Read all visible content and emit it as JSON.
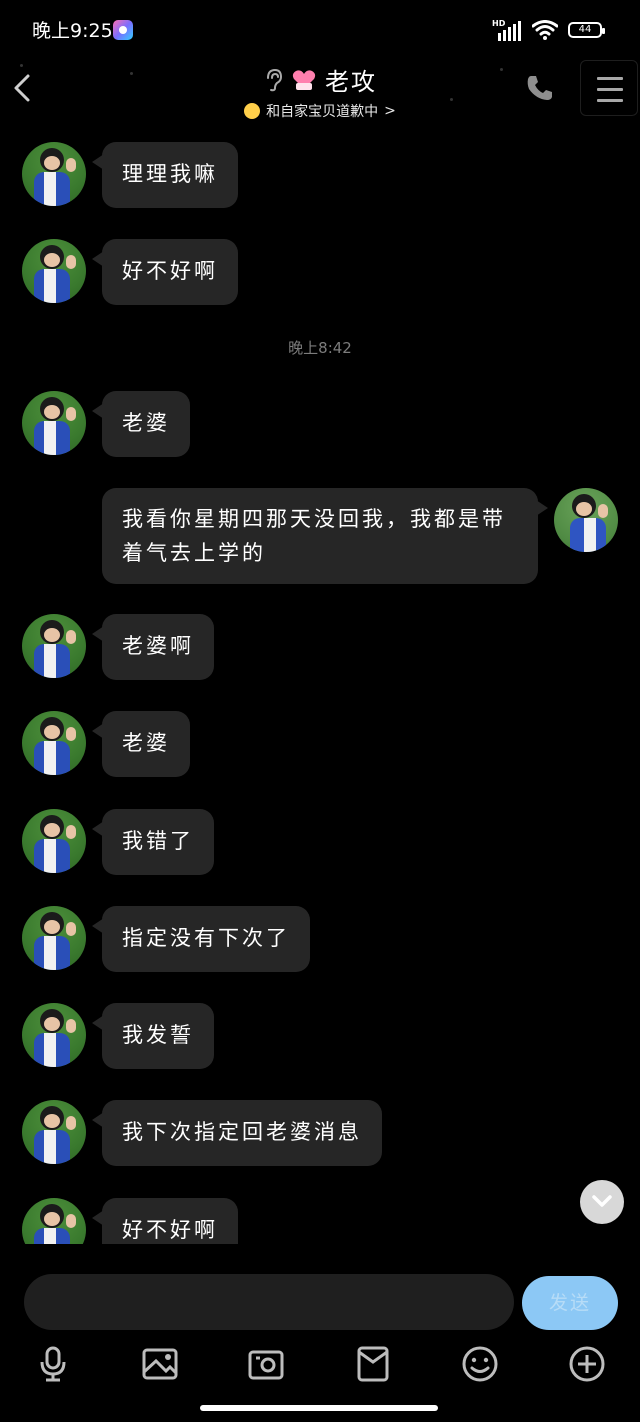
{
  "status_bar": {
    "time": "晚上9:25",
    "network_label": "HD",
    "battery": "44"
  },
  "header": {
    "title": "老攻",
    "subtitle": "和自家宝贝道歉中",
    "subtitle_chevron": ">"
  },
  "timestamp": "晚上8:42",
  "messages": [
    {
      "side": "left",
      "text": "理理我嘛"
    },
    {
      "side": "left",
      "text": "好不好啊"
    },
    {
      "side": "left",
      "text": "老婆"
    },
    {
      "side": "right",
      "text": "我看你星期四那天没回我，我都是带着气去上学的"
    },
    {
      "side": "left",
      "text": "老婆啊"
    },
    {
      "side": "left",
      "text": "老婆"
    },
    {
      "side": "left",
      "text": "我错了"
    },
    {
      "side": "left",
      "text": "指定没有下次了"
    },
    {
      "side": "left",
      "text": "我发誓"
    },
    {
      "side": "left",
      "text": "我下次指定回老婆消息"
    },
    {
      "side": "left",
      "text": "好不好啊"
    }
  ],
  "composer": {
    "input_value": "",
    "send_label": "发送"
  },
  "toolbar": {
    "icons": [
      "microphone-icon",
      "image-icon",
      "camera-icon",
      "red-packet-icon",
      "emoji-icon",
      "plus-icon"
    ]
  },
  "colors": {
    "background": "#000000",
    "bubble": "#262626",
    "send_button": "#8cc8f5",
    "timestamp": "#7c7c7c"
  }
}
